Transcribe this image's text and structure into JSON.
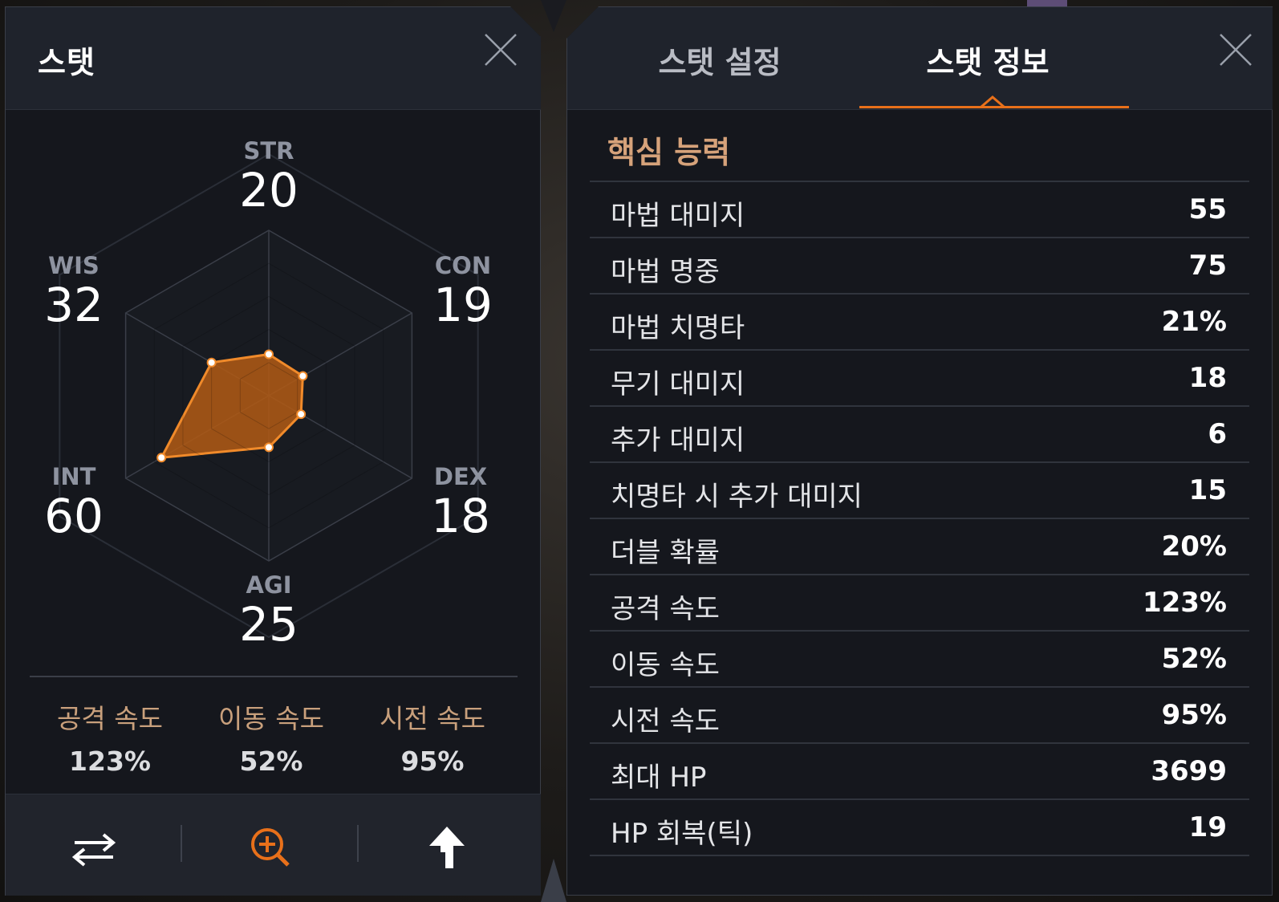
{
  "left_panel": {
    "title": "스탯",
    "radar": {
      "max": 80,
      "rings": 5,
      "stats": [
        {
          "key": "STR",
          "label": "STR",
          "value": 20
        },
        {
          "key": "CON",
          "label": "CON",
          "value": 19
        },
        {
          "key": "DEX",
          "label": "DEX",
          "value": 18
        },
        {
          "key": "AGI",
          "label": "AGI",
          "value": 25
        },
        {
          "key": "INT",
          "label": "INT",
          "value": 60
        },
        {
          "key": "WIS",
          "label": "WIS",
          "value": 32
        }
      ],
      "fill_color": "#b35a14",
      "stroke_color": "#f08a2a"
    },
    "speeds": [
      {
        "label": "공격 속도",
        "value": "123%"
      },
      {
        "label": "이동 속도",
        "value": "52%"
      },
      {
        "label": "시전 속도",
        "value": "95%"
      }
    ],
    "footer_icons": [
      "swap-icon",
      "zoom-in-icon",
      "upload-arrow-icon"
    ]
  },
  "right_panel": {
    "tabs": [
      {
        "label": "스탯 설정",
        "active": false
      },
      {
        "label": "스탯 정보",
        "active": true
      }
    ],
    "section_title": "핵심 능력",
    "rows": [
      {
        "name": "마법 대미지",
        "value": "55"
      },
      {
        "name": "마법 명중",
        "value": "75"
      },
      {
        "name": "마법 치명타",
        "value": "21%"
      },
      {
        "name": "무기 대미지",
        "value": "18"
      },
      {
        "name": "추가 대미지",
        "value": "6"
      },
      {
        "name": "치명타 시 추가 대미지",
        "value": "15"
      },
      {
        "name": "더블 확률",
        "value": "20%"
      },
      {
        "name": "공격 속도",
        "value": "123%"
      },
      {
        "name": "이동 속도",
        "value": "52%"
      },
      {
        "name": "시전 속도",
        "value": "95%"
      },
      {
        "name": "최대 HP",
        "value": "3699"
      },
      {
        "name": "HP 회복(틱)",
        "value": "19"
      }
    ]
  },
  "colors": {
    "accent": "#e8701a",
    "section_title": "#d6a27a",
    "speed_label": "#c9a07c"
  }
}
